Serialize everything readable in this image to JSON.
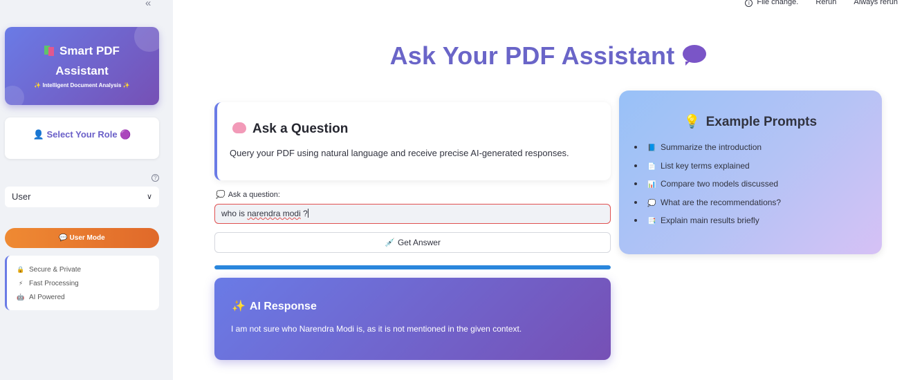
{
  "sidebar": {
    "collapse_icon": "«",
    "brand": {
      "title_line1": "Smart PDF",
      "title_line2": "Assistant",
      "tagline": "✨ Intelligent Document Analysis ✨"
    },
    "role_card": {
      "label": "👤 Select Your Role 🟣"
    },
    "help_icon": "?",
    "role_select": {
      "value": "User",
      "chevron": "⌄"
    },
    "mode_pill": {
      "label": "💬 User Mode"
    },
    "features": [
      {
        "icon": "🔒",
        "label": "Secure & Private"
      },
      {
        "icon": "⚡",
        "label": "Fast Processing"
      },
      {
        "icon": "🤖",
        "label": "AI Powered"
      }
    ]
  },
  "topbar": {
    "info_icon": "i",
    "status": "File change.",
    "rerun": "Rerun",
    "always_rerun": "Always rerun"
  },
  "main": {
    "title": "Ask Your PDF Assistant",
    "ask_card": {
      "heading": "Ask a Question",
      "description": "Query your PDF using natural language and receive precise AI-generated responses."
    },
    "question": {
      "label_icon": "💭",
      "label": "Ask a question:",
      "value_prefix": "who is ",
      "value_flagged": "narendra modi",
      "value_suffix": " ?"
    },
    "answer_button": {
      "icon": "💉",
      "label": "Get Answer"
    },
    "progress": {
      "fraction": 1.0
    },
    "response": {
      "heading_icon": "✨",
      "heading": "AI Response",
      "text": "I am not sure who Narendra Modi is, as it is not mentioned in the given context."
    },
    "examples": {
      "heading_icon": "💡",
      "heading": "Example Prompts",
      "items": [
        {
          "icon": "📘",
          "text": "Summarize the introduction"
        },
        {
          "icon": "📄",
          "text": "List key terms explained"
        },
        {
          "icon": "📊",
          "text": "Compare two models discussed"
        },
        {
          "icon": "💭",
          "text": "What are the recommendations?"
        },
        {
          "icon": "📑",
          "text": "Explain main results briefly"
        }
      ]
    }
  },
  "colors": {
    "accent": "#6a65c8",
    "gradient_start": "#6a7be6",
    "gradient_end": "#7650b5",
    "orange": "#ef8a33",
    "progress": "#2a86dc",
    "error_border": "#e05050"
  }
}
